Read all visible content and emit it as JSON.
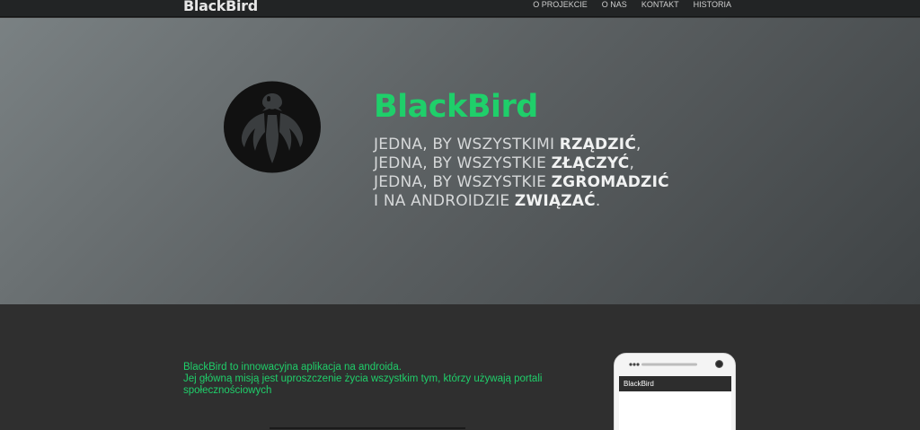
{
  "navbar": {
    "brand": "BlackBird",
    "items": [
      {
        "label": "O PROJEKCIE"
      },
      {
        "label": "O NAS"
      },
      {
        "label": "KONTAKT"
      },
      {
        "label": "HISTORIA"
      }
    ]
  },
  "hero": {
    "title": "BlackBird",
    "logo_icon": "blackbird-logo-icon",
    "accent_color": "#1fcf6a",
    "tagline": [
      {
        "text": "JEDNA, BY WSZYSTKIMI ",
        "bold": "RZĄDZIĆ",
        "tail": ","
      },
      {
        "text": "JEDNA, BY WSZYSTKIE ",
        "bold": "ZŁĄCZYĆ",
        "tail": ","
      },
      {
        "text": "JEDNA, BY WSZYSTKIE ",
        "bold": "ZGROMADZIĆ",
        "tail": ""
      },
      {
        "text": "I NA ANDROIDZIE ",
        "bold": "ZWIĄZAĆ",
        "tail": "."
      }
    ]
  },
  "about": {
    "line1": "BlackBird to innowacyjna aplikacja na androida.",
    "line2": "Jej główną misją jest uproszczenie życia wszystkim tym, którzy używają portali społecznościowych"
  },
  "phone": {
    "app_title": "BlackBird"
  }
}
